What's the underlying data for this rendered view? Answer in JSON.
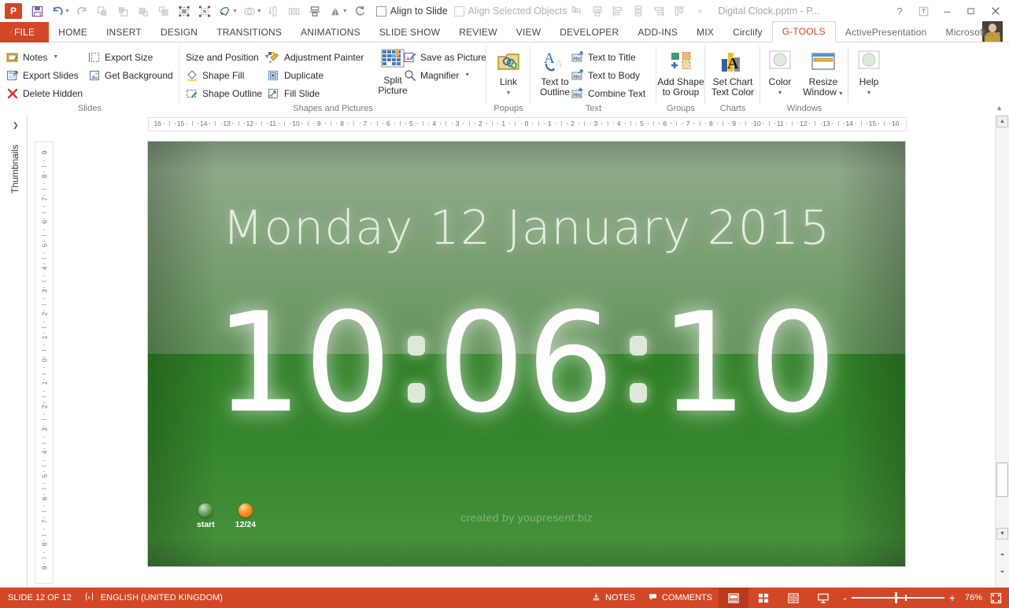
{
  "window": {
    "document_title": "Digital Clock.pptm - P...",
    "logo_text": "P",
    "help_icon": "?",
    "ribbon_display_icon": "ribbon-display-options-icon",
    "minimize_icon": "minimize-icon",
    "maximize_icon": "maximize-icon",
    "close_icon": "close-icon"
  },
  "qat": {
    "items": [
      {
        "name": "save-icon",
        "glyph": "▣",
        "state": "active"
      },
      {
        "name": "undo-icon",
        "glyph": "↶",
        "state": "active",
        "caret": true
      },
      {
        "name": "redo-icon",
        "glyph": "↻",
        "state": "disabled"
      },
      {
        "name": "bring-forward-icon",
        "glyph": "⧉",
        "state": "disabled"
      },
      {
        "name": "send-backward-icon",
        "glyph": "⧉",
        "state": "disabled"
      },
      {
        "name": "bring-to-front-icon",
        "glyph": "■",
        "state": "disabled"
      },
      {
        "name": "send-to-back-icon",
        "glyph": "□",
        "state": "disabled"
      },
      {
        "name": "group-icon",
        "glyph": "⬚",
        "state": "active"
      },
      {
        "name": "ungroup-icon",
        "glyph": "⬚",
        "state": "active"
      },
      {
        "name": "shapes-icon",
        "glyph": "⬠",
        "state": "active",
        "caret": true
      },
      {
        "name": "merge-shapes-icon",
        "glyph": "◎",
        "state": "disabled",
        "caret": true
      },
      {
        "name": "align-top-icon",
        "glyph": "↕",
        "state": "disabled"
      },
      {
        "name": "distribute-horizontally-icon",
        "glyph": "‖",
        "state": "disabled"
      },
      {
        "name": "align-center-icon",
        "glyph": "┳",
        "state": "active"
      },
      {
        "name": "rotate-objects-icon",
        "glyph": "◢",
        "state": "active",
        "caret": true
      },
      {
        "name": "rotate-icon",
        "glyph": "↻",
        "state": "active"
      }
    ],
    "align_to_slide_label": "Align to Slide",
    "align_selected_objects_label": "Align Selected Objects",
    "items2": [
      {
        "name": "align-bottom-icon",
        "glyph": "⤓"
      },
      {
        "name": "align-middle-icon",
        "glyph": "⬥"
      },
      {
        "name": "align-left-icon",
        "glyph": "⇤"
      },
      {
        "name": "distribute-vertically-icon",
        "glyph": "⫼"
      },
      {
        "name": "align-right-icon",
        "glyph": "⇥"
      },
      {
        "name": "align-top-edges-icon",
        "glyph": "⤒"
      },
      {
        "name": "qat-overflow-icon",
        "glyph": "»"
      }
    ]
  },
  "tabs": [
    {
      "label": "FILE",
      "kind": "file"
    },
    {
      "label": "HOME",
      "kind": "normal"
    },
    {
      "label": "INSERT",
      "kind": "normal"
    },
    {
      "label": "DESIGN",
      "kind": "normal"
    },
    {
      "label": "TRANSITIONS",
      "kind": "normal"
    },
    {
      "label": "ANIMATIONS",
      "kind": "normal"
    },
    {
      "label": "SLIDE SHOW",
      "kind": "normal"
    },
    {
      "label": "REVIEW",
      "kind": "normal"
    },
    {
      "label": "VIEW",
      "kind": "normal"
    },
    {
      "label": "DEVELOPER",
      "kind": "normal"
    },
    {
      "label": "ADD-INS",
      "kind": "normal"
    },
    {
      "label": "MIX",
      "kind": "normal"
    },
    {
      "label": "Circlify",
      "kind": "normal"
    },
    {
      "label": "G-TOOLS",
      "kind": "active"
    },
    {
      "label": "ActivePresentation",
      "kind": "gray"
    },
    {
      "label": "Microsoft...",
      "kind": "gray",
      "caret": true
    }
  ],
  "ribbon": {
    "groups": [
      {
        "name": "slides",
        "label": "Slides",
        "col1": [
          {
            "label": "Notes",
            "icon": "notes-icon",
            "caret": true
          },
          {
            "label": "Export Slides",
            "icon": "export-slides-icon",
            "caret": false
          },
          {
            "label": "Delete Hidden",
            "icon": "delete-hidden-icon",
            "caret": false
          }
        ],
        "col2": [
          {
            "label": "Export Size",
            "icon": "export-size-icon",
            "caret": false
          },
          {
            "label": "Get Background",
            "icon": "get-background-icon",
            "caret": false
          }
        ]
      },
      {
        "name": "shapes-and-pictures",
        "label": "Shapes and Pictures",
        "col1": [
          {
            "label": "Size and Position",
            "icon": "size-and-position-icon",
            "caret": true
          },
          {
            "label": "Shape Fill",
            "icon": "shape-fill-icon",
            "caret": false
          },
          {
            "label": "Shape Outline",
            "icon": "shape-outline-icon",
            "caret": false
          }
        ],
        "col2": [
          {
            "label": "Adjustment Painter",
            "icon": "adjustment-painter-icon",
            "caret": false
          },
          {
            "label": "Duplicate",
            "icon": "duplicate-icon",
            "caret": false
          },
          {
            "label": "Fill Slide",
            "icon": "fill-slide-icon",
            "caret": false
          }
        ],
        "big": {
          "label": "Split\nPicture",
          "label_l1": "Split",
          "label_l2": "Picture",
          "icon": "split-picture-icon"
        },
        "col3": [
          {
            "label": "Save as Picture",
            "icon": "save-as-picture-icon",
            "caret": false
          },
          {
            "label": "Magnifier",
            "icon": "magnifier-icon",
            "caret": true
          }
        ]
      },
      {
        "name": "popups",
        "label": "Popups",
        "big": {
          "label_l1": "Link",
          "label_l2": "",
          "icon": "link-icon",
          "caret": true
        }
      },
      {
        "name": "text",
        "label": "Text",
        "big": {
          "label_l1": "Text to",
          "label_l2": "Outline",
          "icon": "text-to-outline-icon"
        },
        "col1": [
          {
            "label": "Text to Title",
            "icon": "text-to-title-icon",
            "caret": false
          },
          {
            "label": "Text to Body",
            "icon": "text-to-body-icon",
            "caret": false
          },
          {
            "label": "Combine Text",
            "icon": "combine-text-icon",
            "caret": false
          }
        ]
      },
      {
        "name": "groups",
        "label": "Groups",
        "big": {
          "label_l1": "Add Shape",
          "label_l2": "to Group",
          "icon": "add-shape-to-group-icon"
        }
      },
      {
        "name": "charts",
        "label": "Charts",
        "big": {
          "label_l1": "Set Chart",
          "label_l2": "Text Color",
          "icon": "set-chart-text-color-icon"
        }
      },
      {
        "name": "windows",
        "label": "Windows",
        "big1": {
          "label_l1": "Color",
          "label_l2": "",
          "icon": "color-icon",
          "caret": true
        },
        "big2": {
          "label_l1": "Resize",
          "label_l2": "Window",
          "icon": "resize-window-icon",
          "caret": true
        }
      },
      {
        "name": "help",
        "label": "",
        "big": {
          "label_l1": "Help",
          "label_l2": "",
          "icon": "help-icon",
          "caret": true
        }
      }
    ],
    "collapse_icon": "collapse-ribbon-icon"
  },
  "thumbnails": {
    "label": "Thumbnails",
    "expand_icon": "chevron-right-icon"
  },
  "rulers": {
    "horizontal": [
      "16",
      "15",
      "14",
      "13",
      "12",
      "11",
      "10",
      "9",
      "8",
      "7",
      "6",
      "5",
      "4",
      "3",
      "2",
      "1",
      "0",
      "1",
      "2",
      "3",
      "4",
      "5",
      "6",
      "7",
      "8",
      "9",
      "10",
      "11",
      "12",
      "13",
      "14",
      "15",
      "16"
    ],
    "vertical": [
      "9",
      "8",
      "7",
      "6",
      "5",
      "4",
      "3",
      "2",
      "1",
      "0",
      "1",
      "2",
      "3",
      "4",
      "5",
      "6",
      "7",
      "8",
      "9"
    ]
  },
  "slide": {
    "date_text": "Monday 12 January 2015",
    "time_hours": "10",
    "time_minutes": "06",
    "time_seconds": "10",
    "credit_text": "created by youpresent.biz",
    "buttons": [
      {
        "label": "start",
        "orb": "start-orb"
      },
      {
        "label": "12/24",
        "orb": "mode-orb"
      }
    ],
    "colors": {
      "top_green": "#93ad8e",
      "bottom_green": "#2f8026",
      "text_white": "#ffffff",
      "accent": "#ff9b28"
    }
  },
  "status_bar": {
    "slide_counter": "SLIDE 12 OF 12",
    "language_icon": "spelling-icon",
    "language": "ENGLISH (UNITED KINGDOM)",
    "notes_label": "NOTES",
    "notes_icon": "notes-icon",
    "comments_label": "COMMENTS",
    "comments_icon": "comment-icon",
    "views": [
      {
        "name": "normal-view-button",
        "icon": "normal-view-icon",
        "selected": true
      },
      {
        "name": "slide-sorter-button",
        "icon": "slide-sorter-icon",
        "selected": false
      },
      {
        "name": "reading-view-button",
        "icon": "reading-view-icon",
        "selected": false
      },
      {
        "name": "slide-show-button",
        "icon": "slide-show-icon",
        "selected": false
      }
    ],
    "zoom_out_label": "-",
    "zoom_in_label": "+",
    "zoom_level": "76%",
    "fit_slide_icon": "fit-to-window-icon",
    "accent_color": "#d24726"
  }
}
